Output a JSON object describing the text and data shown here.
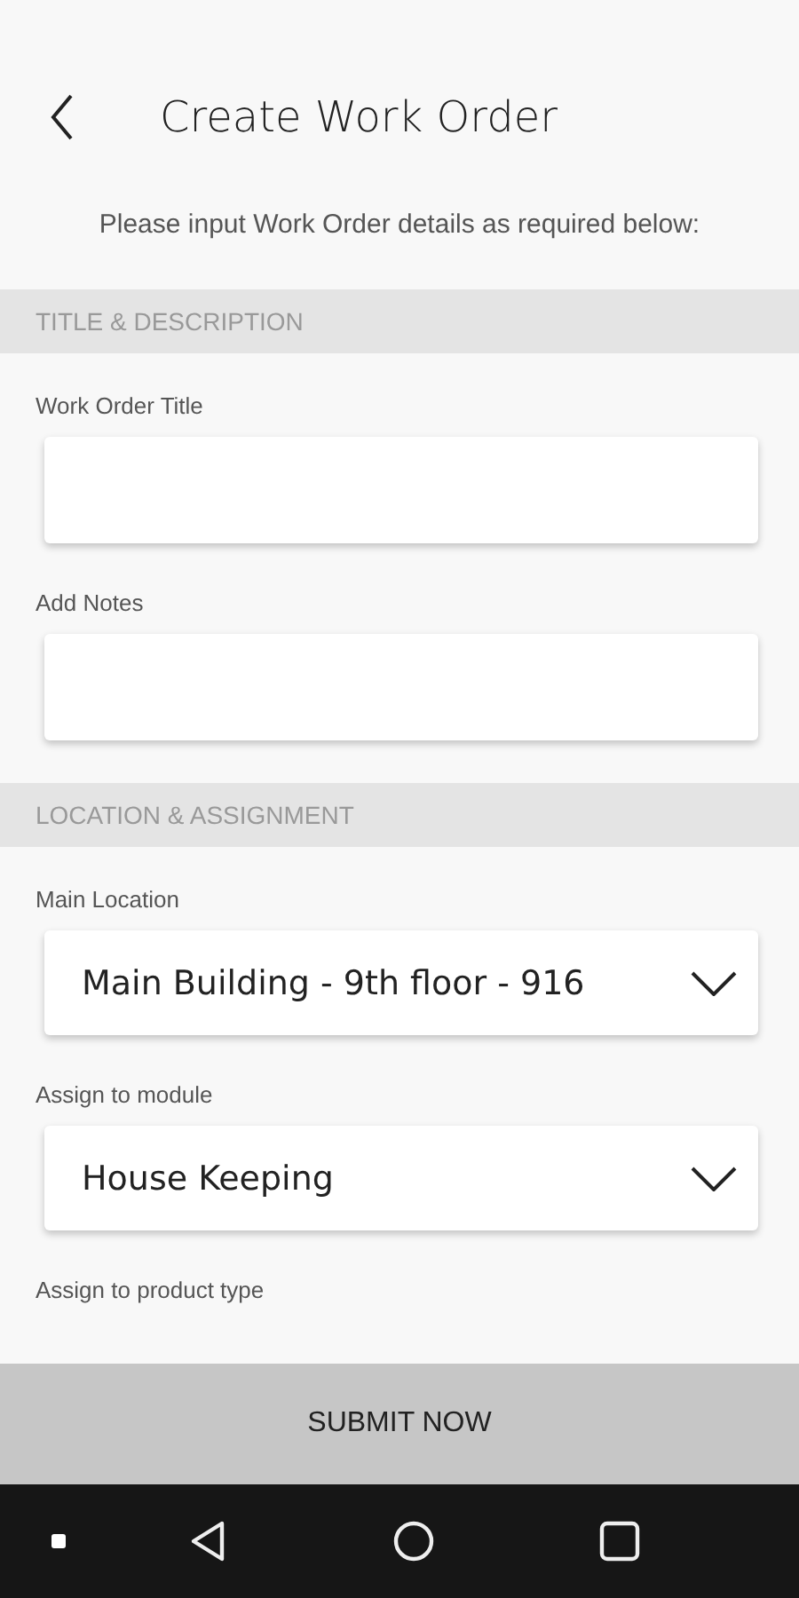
{
  "header": {
    "title": "Create Work Order"
  },
  "intro": "Please input Work Order details as required below:",
  "sections": [
    {
      "heading": "TITLE & DESCRIPTION",
      "fields": [
        {
          "kind": "text",
          "label": "Work Order Title"
        },
        {
          "kind": "text",
          "label": "Add Notes"
        }
      ]
    },
    {
      "heading": "LOCATION & ASSIGNMENT",
      "fields": [
        {
          "kind": "select",
          "label": "Main Location",
          "value": "Main Building - 9th floor - 916"
        },
        {
          "kind": "select",
          "label": "Assign to module",
          "value": "House Keeping"
        },
        {
          "kind": "label",
          "label": "Assign to product type"
        }
      ]
    }
  ],
  "submit": "SUBMIT NOW"
}
